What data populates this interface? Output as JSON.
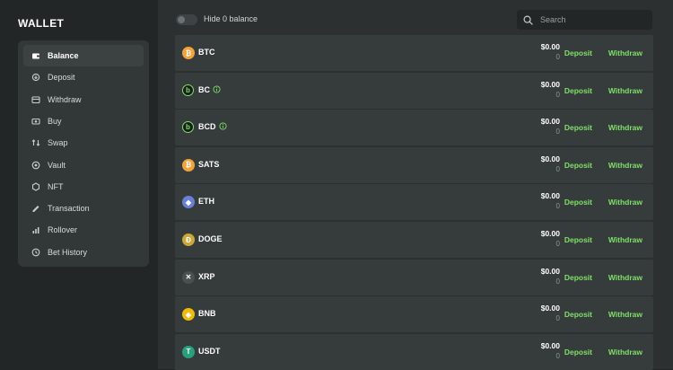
{
  "sidebar": {
    "title": "WALLET",
    "items": [
      {
        "label": "Balance",
        "icon": "wallet-icon",
        "active": true
      },
      {
        "label": "Deposit",
        "icon": "deposit-icon"
      },
      {
        "label": "Withdraw",
        "icon": "withdraw-icon"
      },
      {
        "label": "Buy",
        "icon": "buy-icon"
      },
      {
        "label": "Swap",
        "icon": "swap-icon"
      },
      {
        "label": "Vault",
        "icon": "vault-icon"
      },
      {
        "label": "NFT",
        "icon": "nft-icon"
      },
      {
        "label": "Transaction",
        "icon": "transaction-icon"
      },
      {
        "label": "Rollover",
        "icon": "rollover-icon"
      },
      {
        "label": "Bet History",
        "icon": "bet-history-icon"
      }
    ]
  },
  "toolbar": {
    "hide_zero_label": "Hide 0 balance",
    "search_placeholder": "Search"
  },
  "coins": [
    {
      "symbol": "BTC",
      "amount": "$0.00",
      "sub": "0",
      "color": "#f2a33a",
      "glyph": "₿",
      "info": false
    },
    {
      "symbol": "BC",
      "amount": "$0.00",
      "sub": "0",
      "color": "#1a1d1d",
      "glyph": "b",
      "info": true
    },
    {
      "symbol": "BCD",
      "amount": "$0.00",
      "sub": "0",
      "color": "#1a1d1d",
      "glyph": "b",
      "info": true
    },
    {
      "symbol": "SATS",
      "amount": "$0.00",
      "sub": "0",
      "color": "#f2a33a",
      "glyph": "₿",
      "info": false
    },
    {
      "symbol": "ETH",
      "amount": "$0.00",
      "sub": "0",
      "color": "#6b7fd7",
      "glyph": "◆",
      "info": false
    },
    {
      "symbol": "DOGE",
      "amount": "$0.00",
      "sub": "0",
      "color": "#c9a93a",
      "glyph": "Đ",
      "info": false
    },
    {
      "symbol": "XRP",
      "amount": "$0.00",
      "sub": "0",
      "color": "#4a4f50",
      "glyph": "✕",
      "info": false
    },
    {
      "symbol": "BNB",
      "amount": "$0.00",
      "sub": "0",
      "color": "#f0b90b",
      "glyph": "◈",
      "info": false
    },
    {
      "symbol": "USDT",
      "amount": "$0.00",
      "sub": "0",
      "color": "#26a17b",
      "glyph": "T",
      "info": false
    }
  ],
  "actions": {
    "deposit": "Deposit",
    "withdraw": "Withdraw"
  },
  "colors": {
    "accent": "#7fe068",
    "panel": "#323738",
    "row": "#363b3c"
  }
}
